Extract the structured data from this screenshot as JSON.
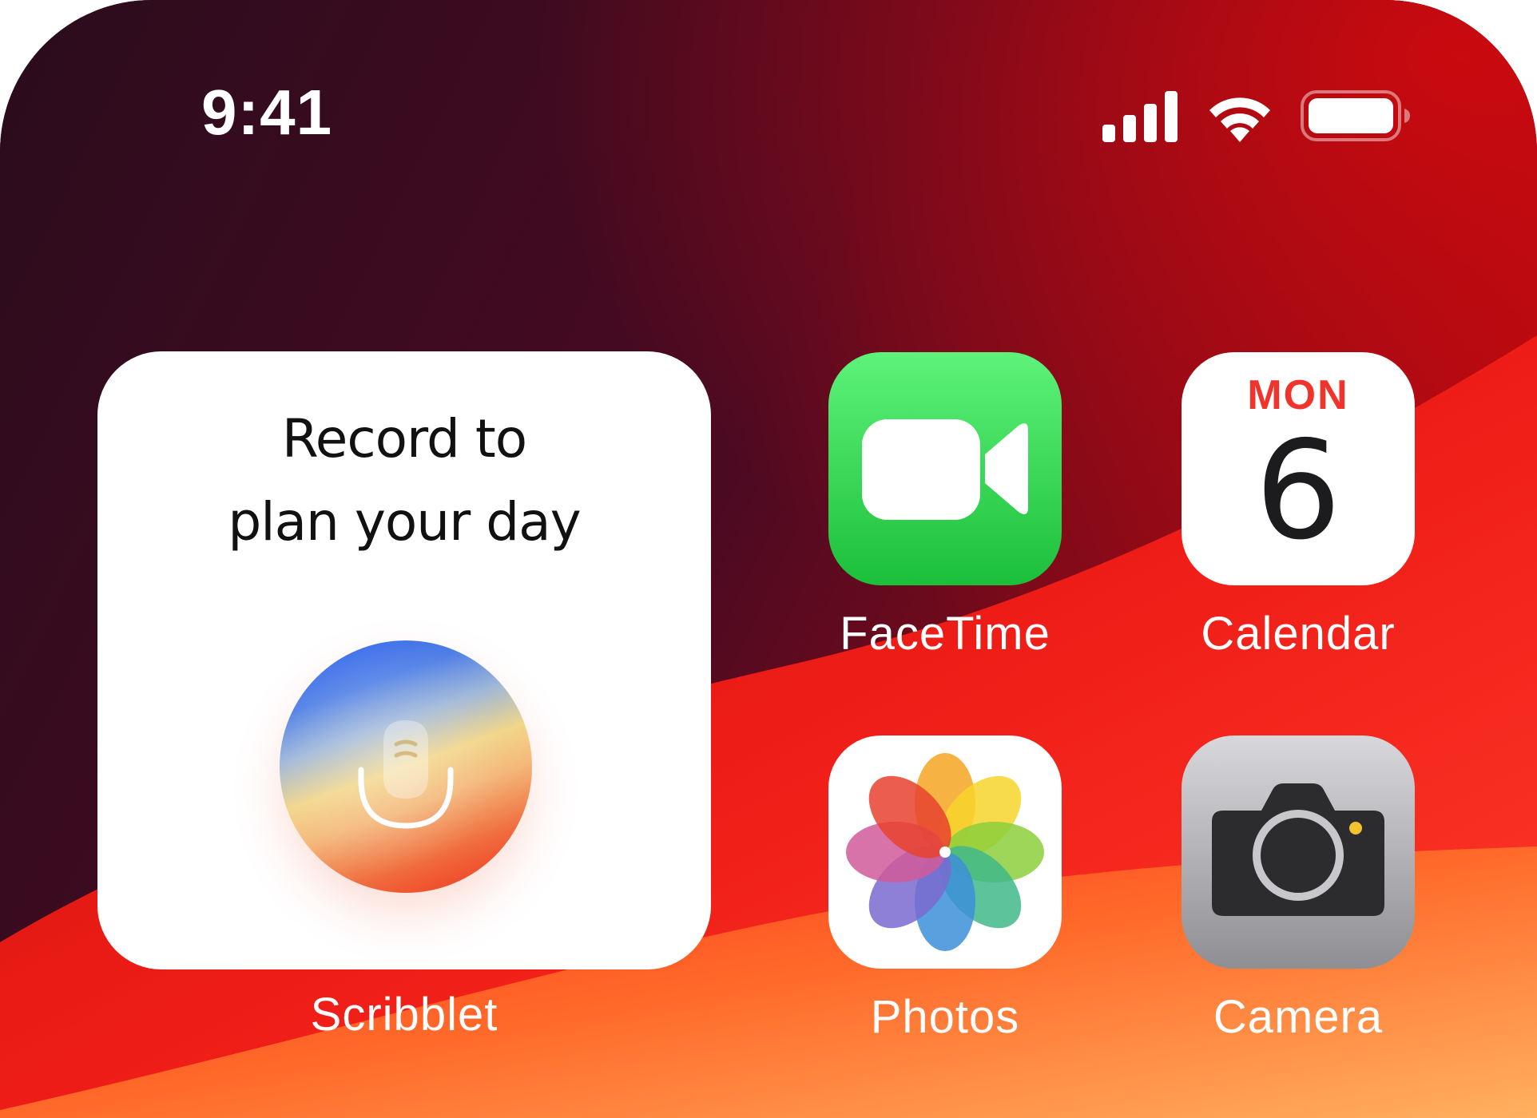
{
  "status_bar": {
    "time": "9:41",
    "signal_icon": "cellular-signal-icon",
    "wifi_icon": "wifi-icon",
    "battery_icon": "battery-icon"
  },
  "widget": {
    "headline_line1": "Record to",
    "headline_line2": "plan your day",
    "button_icon": "microphone-icon",
    "label": "Scribblet"
  },
  "apps": [
    {
      "label": "FaceTime",
      "icon": "facetime-video-icon"
    },
    {
      "label": "Calendar",
      "icon": "calendar-icon",
      "day": "MON",
      "date": "6"
    },
    {
      "label": "Photos",
      "icon": "photos-flower-icon"
    },
    {
      "label": "Camera",
      "icon": "camera-icon"
    }
  ],
  "colors": {
    "wallpaper_dark": "#3a0a1e",
    "wallpaper_red": "#e8241a",
    "wallpaper_orange": "#ffa54a",
    "facetime_green": "#1bbf3a",
    "calendar_red": "#f0342c"
  }
}
